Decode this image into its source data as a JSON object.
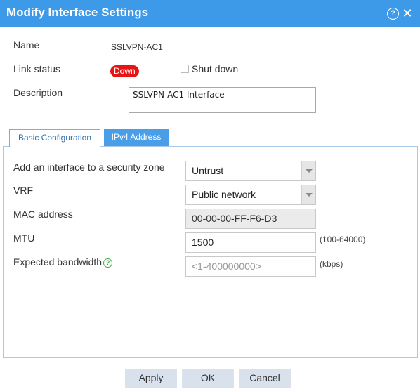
{
  "dialog": {
    "title": "Modify Interface Settings"
  },
  "info": {
    "name_label": "Name",
    "name_value": "SSLVPN-AC1",
    "link_status_label": "Link status",
    "link_status_value": "Down",
    "shutdown_label": "Shut down",
    "shutdown_checked": false,
    "description_label": "Description",
    "description_value": "SSLVPN-AC1 Interface"
  },
  "tabs": [
    {
      "label": "Basic Configuration",
      "active": true
    },
    {
      "label": "IPv4 Address",
      "active": false
    }
  ],
  "form": {
    "zone_label": "Add an interface to a security zone",
    "zone_value": "Untrust",
    "vrf_label": "VRF",
    "vrf_value": "Public network",
    "mac_label": "MAC address",
    "mac_value": "00-00-00-FF-F6-D3",
    "mtu_label": "MTU",
    "mtu_value": "1500",
    "mtu_hint": "(100-64000)",
    "bandwidth_label": "Expected bandwidth",
    "bandwidth_placeholder": "<1-400000000>",
    "bandwidth_hint": "(kbps)"
  },
  "buttons": {
    "apply": "Apply",
    "ok": "OK",
    "cancel": "Cancel"
  },
  "icons": {
    "help": "?",
    "close": "✕",
    "field_help": "?"
  },
  "colors": {
    "titlebar": "#3d9ae8",
    "status_down": "#e81414",
    "tab_inactive": "#4a9ee8",
    "help_green": "#3cae3c"
  }
}
